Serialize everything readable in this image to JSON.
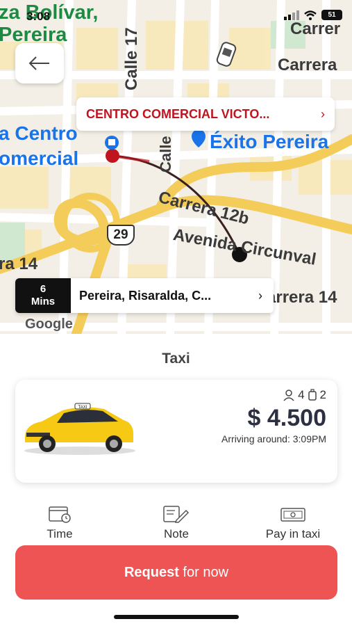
{
  "status_bar": {
    "time": "3:08",
    "battery": "51"
  },
  "map": {
    "labels": {
      "plaza_bolivar": "za Bolívar,",
      "pereira": "Pereira",
      "carrera_top": "Carrer",
      "carrera_right": "Carrera",
      "calle_17": "Calle 17",
      "calle_mid": "Calle",
      "centro_comercial_1": "a Centro",
      "centro_comercial_2": "omercial",
      "exito": "Éxito Pereira",
      "carrera_12b": "Carrera 12b",
      "avenida": "Avenida Circunval",
      "carrera_14_left": "ra 14",
      "carrera_14_right": "arrera 14",
      "route_shield": "29",
      "google": "Google"
    },
    "destination": {
      "text": "CENTRO COMERCIAL VICTO...",
      "chevron": "›"
    },
    "origin": {
      "eta_value": "6",
      "eta_unit": "Mins",
      "text": "Pereira, Risaralda, C...",
      "chevron": "›"
    },
    "back_icon": "arrow-left-icon"
  },
  "service": {
    "title": "Taxi"
  },
  "ride": {
    "passengers": "4",
    "luggage": "2",
    "price": "$ 4.500",
    "arriving": "Arriving around: 3:09PM",
    "car_roof_sign": "TAXI"
  },
  "options": [
    {
      "label": "Time",
      "icon": "calendar-clock-icon"
    },
    {
      "label": "Note",
      "icon": "note-edit-icon"
    },
    {
      "label": "Pay in taxi",
      "icon": "cash-icon"
    }
  ],
  "request": {
    "bold": "Request",
    "rest": " for now"
  },
  "colors": {
    "accent_red": "#ef5454",
    "brand_red": "#c0141e",
    "map_blue": "#1a73e8",
    "map_green": "#1d8a44",
    "taxi_yellow": "#f6c914"
  }
}
